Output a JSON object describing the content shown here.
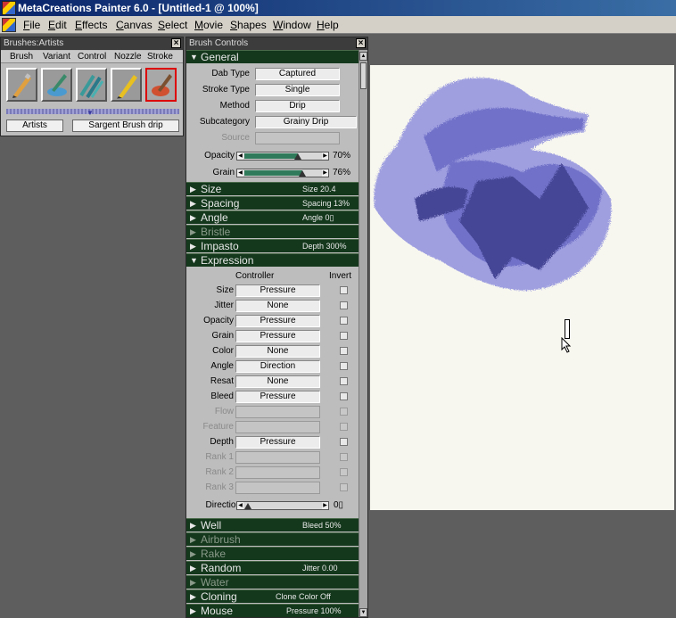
{
  "window": {
    "title": "MetaCreations Painter 6.0 - [Untitled-1 @ 100%]"
  },
  "menubar": {
    "items": [
      "File",
      "Edit",
      "Effects",
      "Canvas",
      "Select",
      "Movie",
      "Shapes",
      "Window",
      "Help"
    ]
  },
  "brushes_palette": {
    "title": "Brushes:Artists",
    "tabs": [
      "Brush",
      "Variant",
      "Control",
      "Nozzle",
      "Stroke"
    ],
    "brush_icons": [
      "brush-stroke-icon",
      "water-brush-icon",
      "felt-pen-icon",
      "pencil-icon",
      "artist-brush-icon"
    ],
    "category": "Artists",
    "variant": "Sargent Brush drip"
  },
  "brush_controls": {
    "title": "Brush Controls",
    "general": {
      "label": "General",
      "dab_type_label": "Dab Type",
      "dab_type": "Captured",
      "stroke_type_label": "Stroke Type",
      "stroke_type": "Single",
      "method_label": "Method",
      "method": "Drip",
      "subcategory_label": "Subcategory",
      "subcategory": "Grainy Drip",
      "source_label": "Source",
      "source": "",
      "opacity_label": "Opacity",
      "opacity_value": "70%",
      "opacity_fraction": 0.7,
      "grain_label": "Grain",
      "grain_value": "76%",
      "grain_fraction": 0.76
    },
    "sections_top": [
      {
        "name": "Size",
        "value": "Size 20.4"
      },
      {
        "name": "Spacing",
        "value": "Spacing 13%"
      },
      {
        "name": "Angle",
        "value": "Angle 0▯"
      },
      {
        "name": "Bristle",
        "value": ""
      },
      {
        "name": "Impasto",
        "value": "Depth 300%"
      }
    ],
    "expression": {
      "label": "Expression",
      "controller_header": "Controller",
      "invert_header": "Invert",
      "rows": [
        {
          "label": "Size",
          "value": "Pressure"
        },
        {
          "label": "Jitter",
          "value": "None"
        },
        {
          "label": "Opacity",
          "value": "Pressure"
        },
        {
          "label": "Grain",
          "value": "Pressure"
        },
        {
          "label": "Color",
          "value": "None"
        },
        {
          "label": "Angle",
          "value": "Direction"
        },
        {
          "label": "Resat",
          "value": "None"
        },
        {
          "label": "Bleed",
          "value": "Pressure"
        },
        {
          "label": "Flow",
          "value": ""
        },
        {
          "label": "Feature",
          "value": ""
        },
        {
          "label": "Depth",
          "value": "Pressure"
        },
        {
          "label": "Rank 1",
          "value": ""
        },
        {
          "label": "Rank 2",
          "value": ""
        },
        {
          "label": "Rank 3",
          "value": ""
        }
      ],
      "direction_label": "Direction",
      "direction_value": "0▯"
    },
    "sections_bottom": [
      {
        "name": "Well",
        "value": "Bleed 50%"
      },
      {
        "name": "Airbrush",
        "value": ""
      },
      {
        "name": "Rake",
        "value": ""
      },
      {
        "name": "Random",
        "value": "Jitter 0.00"
      },
      {
        "name": "Water",
        "value": ""
      },
      {
        "name": "Cloning",
        "value": "Clone Color Off"
      },
      {
        "name": "Mouse",
        "value": "Pressure 100%"
      }
    ]
  },
  "colors": {
    "stroke_light": "#9b9be0",
    "stroke_mid": "#6a6ac8",
    "stroke_dark": "#3d3d92",
    "section_bg": "#14381c",
    "canvas_bg": "#f8f7ef"
  }
}
